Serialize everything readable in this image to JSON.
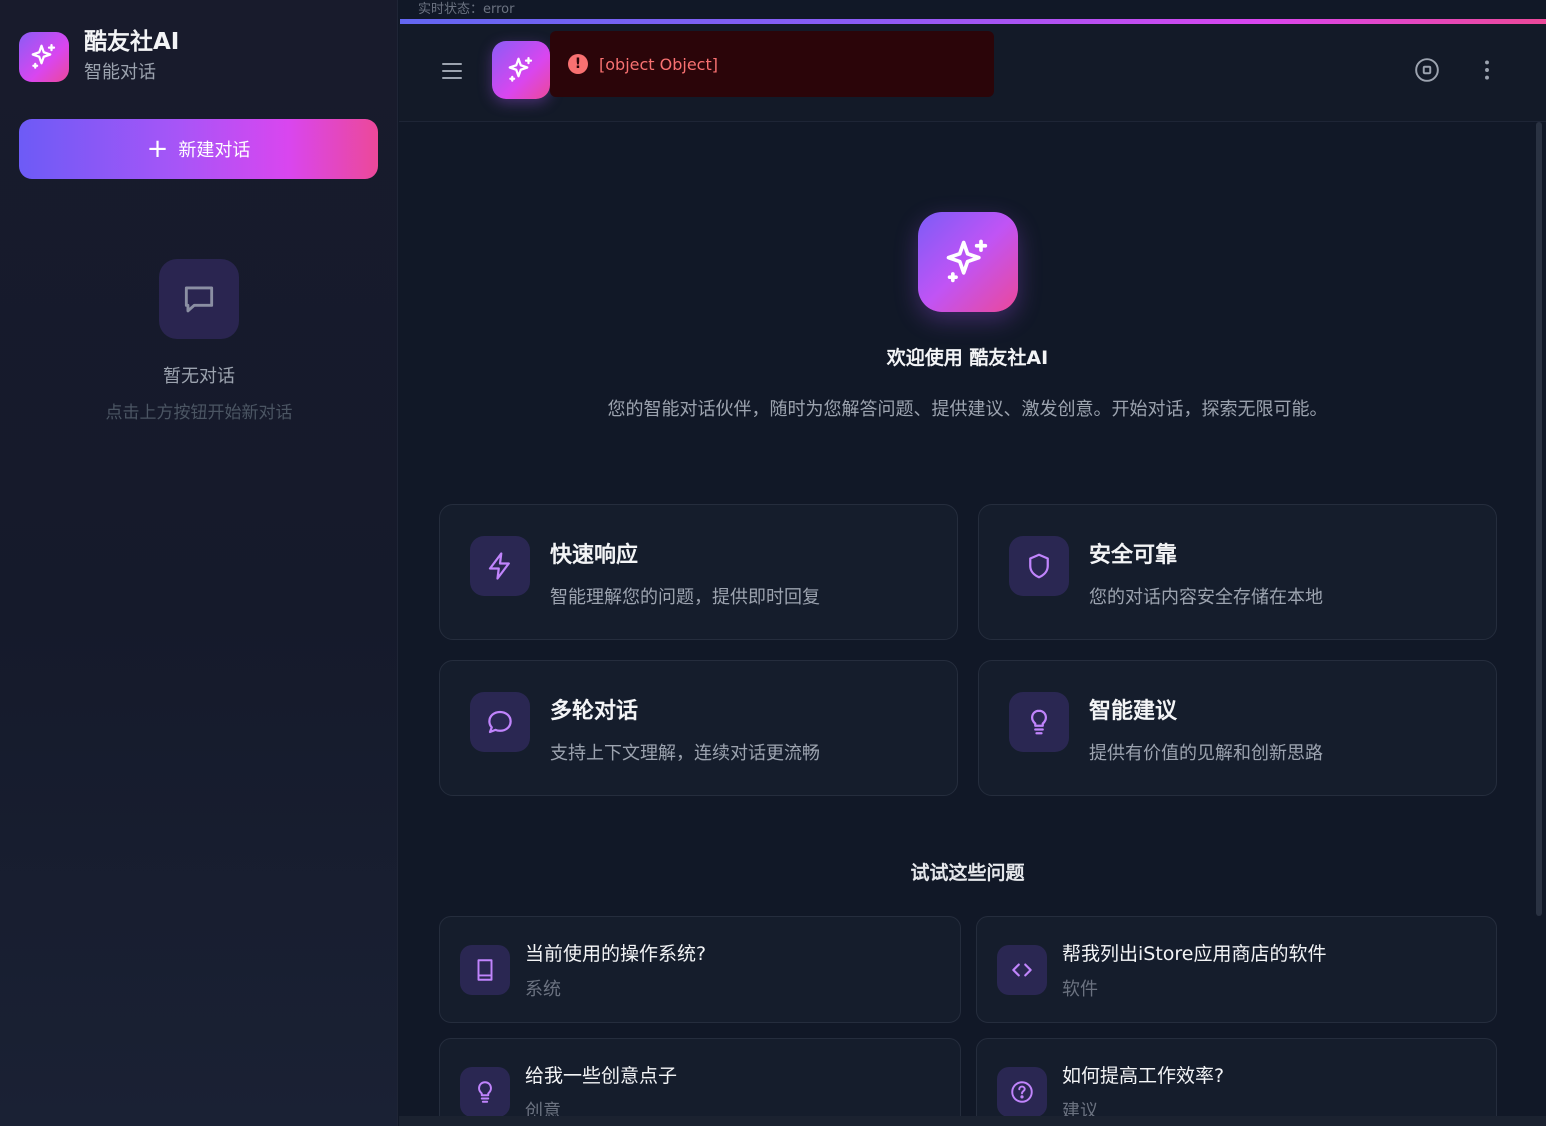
{
  "sidebar": {
    "brand_title": "酷友社AI",
    "brand_subtitle": "智能对话",
    "new_chat_label": "新建对话",
    "empty_title": "暂无对话",
    "empty_subtitle": "点击上方按钮开始新对话"
  },
  "status": {
    "text": "实时状态：error"
  },
  "toast": {
    "message": "[object Object]",
    "icon": "!"
  },
  "main": {
    "welcome_title": "欢迎使用 酷友社AI",
    "welcome_subtitle": "您的智能对话伙伴，随时为您解答问题、提供建议、激发创意。开始对话，探索无限可能。",
    "features": [
      {
        "title": "快速响应",
        "desc": "智能理解您的问题，提供即时回复",
        "icon": "lightning-icon"
      },
      {
        "title": "安全可靠",
        "desc": "您的对话内容安全存储在本地",
        "icon": "shield-icon"
      },
      {
        "title": "多轮对话",
        "desc": "支持上下文理解，连续对话更流畅",
        "icon": "chat-bubble-icon"
      },
      {
        "title": "智能建议",
        "desc": "提供有价值的见解和创新思路",
        "icon": "lightbulb-icon"
      }
    ],
    "try_title": "试试这些问题",
    "questions": [
      {
        "title": "当前使用的操作系统?",
        "category": "系统",
        "icon": "book-icon"
      },
      {
        "title": "帮我列出iStore应用商店的软件",
        "category": "软件",
        "icon": "code-icon"
      },
      {
        "title": "给我一些创意点子",
        "category": "创意",
        "icon": "lightbulb-icon"
      },
      {
        "title": "如何提高工作效率?",
        "category": "建议",
        "icon": "help-circle-icon"
      }
    ]
  },
  "colors": {
    "accent_start": "#8b5cf6",
    "accent_end": "#ec4899",
    "error": "#f87171",
    "background": "#111827"
  }
}
